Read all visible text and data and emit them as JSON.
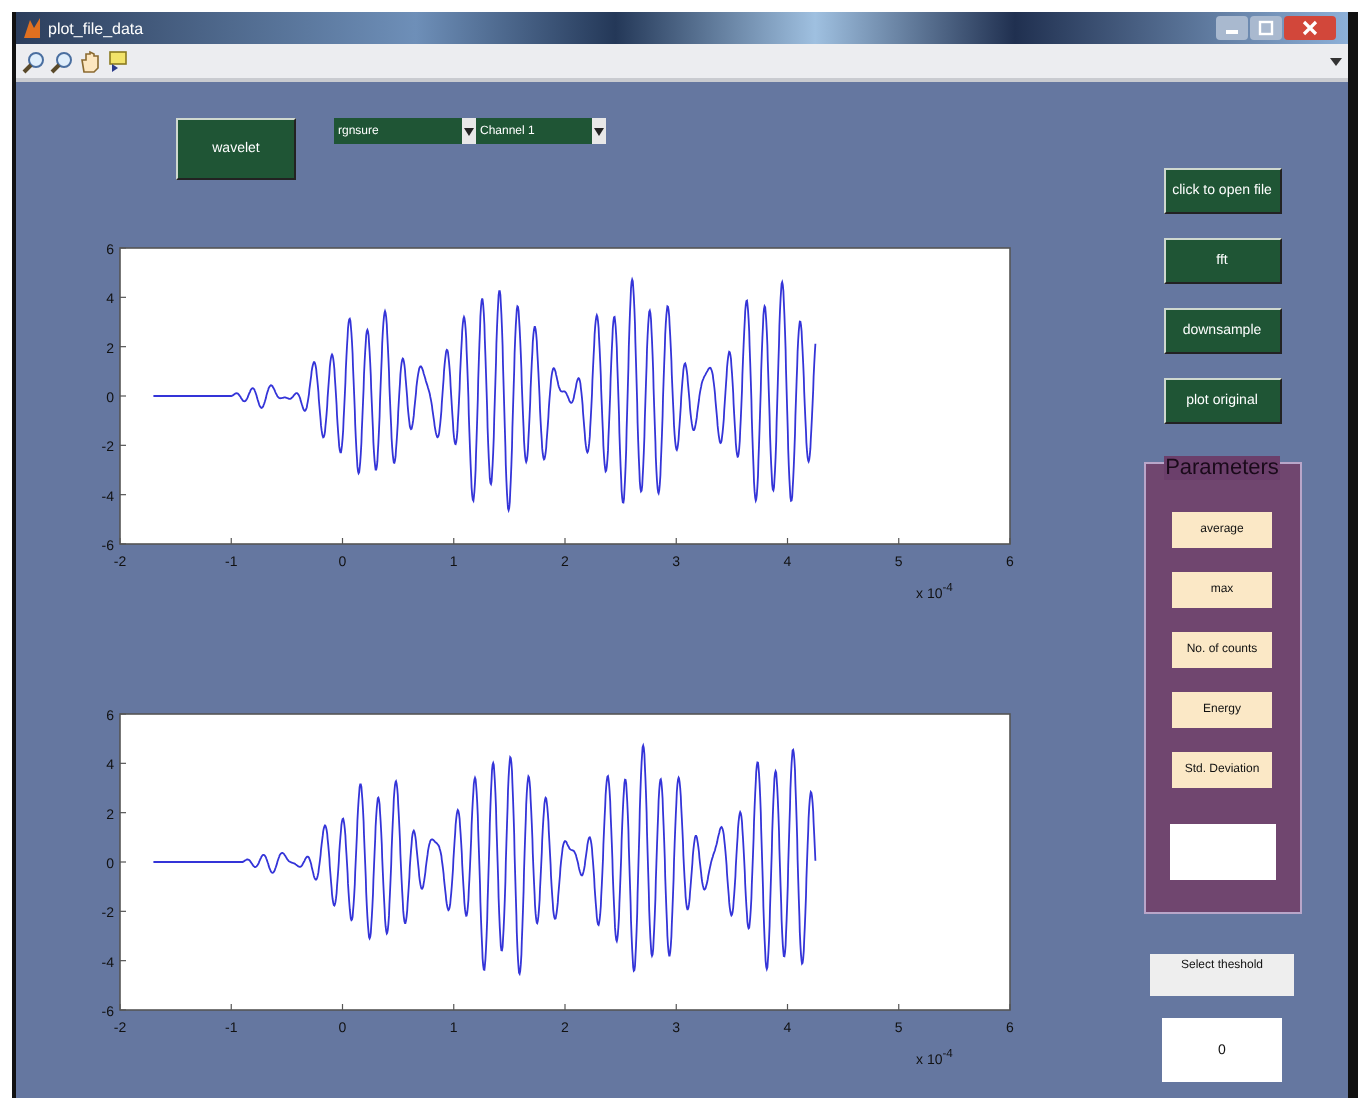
{
  "window": {
    "title": "plot_file_data"
  },
  "top_controls": {
    "wavelet_button": "wavelet",
    "dropdowns": [
      {
        "value": "rgnsure"
      },
      {
        "value": "Channel 1"
      }
    ]
  },
  "plots": [
    {
      "x_ticks": [
        "-2",
        "-1",
        "0",
        "1",
        "2",
        "3",
        "4",
        "5",
        "6"
      ],
      "y_ticks": [
        "6",
        "4",
        "2",
        "0",
        "-2",
        "-4",
        "-6"
      ],
      "exponent": "x 10$^{-4}$"
    },
    {
      "x_ticks": [
        "-2",
        "-1",
        "0",
        "1",
        "2",
        "3",
        "4",
        "5",
        "6"
      ],
      "y_ticks": [
        "6",
        "4",
        "2",
        "0",
        "-2",
        "-4",
        "-6"
      ],
      "exponent": "x 10$^{-4}$"
    }
  ],
  "side_buttons": [
    "click to open file",
    "fft",
    "downsample",
    "plot original"
  ],
  "parameters": {
    "title": "Parameters",
    "buttons": [
      "average",
      "max",
      "No. of counts",
      "Energy",
      "Std. Deviation"
    ]
  },
  "threshold": {
    "label": "Select theshold",
    "value": "0"
  }
}
